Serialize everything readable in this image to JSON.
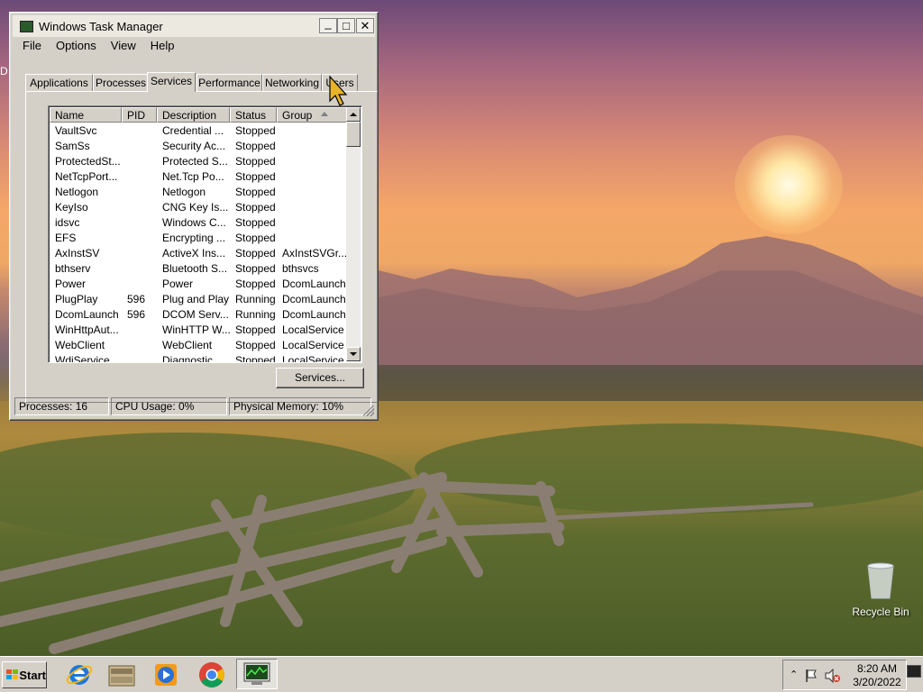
{
  "desktop": {
    "left_edge_text": "D",
    "recycle_bin_label": "Recycle Bin"
  },
  "window": {
    "title": "Windows Task Manager",
    "controls": {
      "minimize": "_",
      "maximize": "□",
      "close": "✕"
    },
    "menu": [
      "File",
      "Options",
      "View",
      "Help"
    ],
    "tabs": [
      "Applications",
      "Processes",
      "Services",
      "Performance",
      "Networking",
      "Users"
    ],
    "active_tab": "Services",
    "columns": [
      "Name",
      "PID",
      "Description",
      "Status",
      "Group"
    ],
    "sorted_column": "Group",
    "rows": [
      [
        "VaultSvc",
        "",
        "Credential ...",
        "Stopped",
        ""
      ],
      [
        "SamSs",
        "",
        "Security Ac...",
        "Stopped",
        ""
      ],
      [
        "ProtectedSt...",
        "",
        "Protected S...",
        "Stopped",
        ""
      ],
      [
        "NetTcpPort...",
        "",
        "Net.Tcp Po...",
        "Stopped",
        ""
      ],
      [
        "Netlogon",
        "",
        "Netlogon",
        "Stopped",
        ""
      ],
      [
        "KeyIso",
        "",
        "CNG Key Is...",
        "Stopped",
        ""
      ],
      [
        "idsvc",
        "",
        "Windows C...",
        "Stopped",
        ""
      ],
      [
        "EFS",
        "",
        "Encrypting ...",
        "Stopped",
        ""
      ],
      [
        "AxInstSV",
        "",
        "ActiveX Ins...",
        "Stopped",
        "AxInstSVGr..."
      ],
      [
        "bthserv",
        "",
        "Bluetooth S...",
        "Stopped",
        "bthsvcs"
      ],
      [
        "Power",
        "",
        "Power",
        "Stopped",
        "DcomLaunch"
      ],
      [
        "PlugPlay",
        "596",
        "Plug and Play",
        "Running",
        "DcomLaunch"
      ],
      [
        "DcomLaunch",
        "596",
        "DCOM Serv...",
        "Running",
        "DcomLaunch"
      ],
      [
        "WinHttpAut...",
        "",
        "WinHTTP W...",
        "Stopped",
        "LocalService"
      ],
      [
        "WebClient",
        "",
        "WebClient",
        "Stopped",
        "LocalService"
      ],
      [
        "WdiService",
        "",
        "Diagnostic ...",
        "Stopped",
        "LocalService"
      ]
    ],
    "services_button": "Services...",
    "status": {
      "processes": "Processes: 16",
      "cpu": "CPU Usage: 0%",
      "memory": "Physical Memory: 10%"
    }
  },
  "taskbar": {
    "start_label": "Start",
    "pinned": [
      "internet-explorer-icon",
      "file-explorer-icon",
      "media-player-icon",
      "chrome-icon",
      "task-manager-icon"
    ],
    "clock_time": "8:20 AM",
    "clock_date": "3/20/2022"
  },
  "colors": {
    "window_face": "#d4d0c8",
    "sky_top": "#6c4a78",
    "sky_glow": "#f4a768",
    "grass": "#5d6b2f"
  }
}
